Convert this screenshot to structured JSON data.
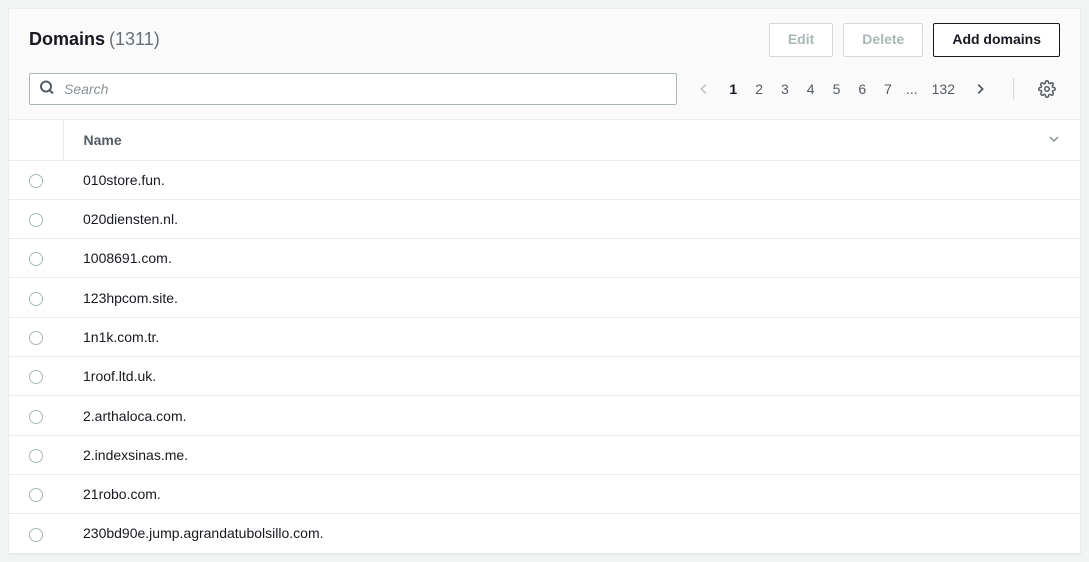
{
  "header": {
    "title": "Domains",
    "count_display": "(1311)"
  },
  "actions": {
    "edit": "Edit",
    "delete": "Delete",
    "add": "Add domains"
  },
  "search": {
    "placeholder": "Search"
  },
  "pagination": {
    "pages": [
      "1",
      "2",
      "3",
      "4",
      "5",
      "6",
      "7"
    ],
    "ellipsis": "...",
    "last": "132",
    "current": "1"
  },
  "columns": {
    "name": "Name"
  },
  "rows": [
    {
      "name": "010store.fun."
    },
    {
      "name": "020diensten.nl."
    },
    {
      "name": "1008691.com."
    },
    {
      "name": "123hpcom.site."
    },
    {
      "name": "1n1k.com.tr."
    },
    {
      "name": "1roof.ltd.uk."
    },
    {
      "name": "2.arthaloca.com."
    },
    {
      "name": "2.indexsinas.me."
    },
    {
      "name": "21robo.com."
    },
    {
      "name": "230bd90e.jump.agrandatubolsillo.com."
    }
  ]
}
